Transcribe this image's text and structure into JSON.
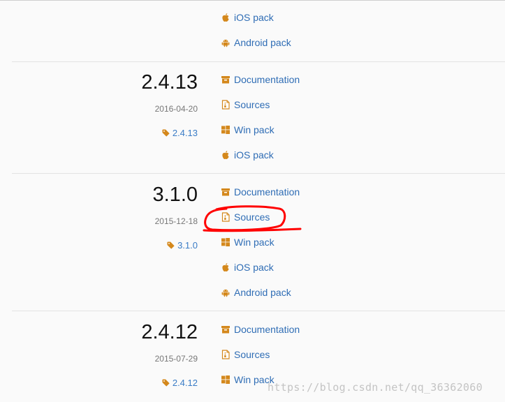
{
  "colors": {
    "icon": "#d4881c",
    "link": "#2f6db5",
    "tag": "#3a7cc6",
    "annotation": "#ff0000"
  },
  "top_links": [
    {
      "label": "iOS pack",
      "icon": "apple-icon"
    },
    {
      "label": "Android pack",
      "icon": "android-icon"
    }
  ],
  "releases": [
    {
      "version": "2.4.13",
      "date": "2016-04-20",
      "tag": "2.4.13",
      "links": [
        {
          "label": "Documentation",
          "icon": "archive-icon"
        },
        {
          "label": "Sources",
          "icon": "file-zip-icon"
        },
        {
          "label": "Win pack",
          "icon": "windows-icon"
        },
        {
          "label": "iOS pack",
          "icon": "apple-icon"
        }
      ]
    },
    {
      "version": "3.1.0",
      "date": "2015-12-18",
      "tag": "3.1.0",
      "links": [
        {
          "label": "Documentation",
          "icon": "archive-icon"
        },
        {
          "label": "Sources",
          "icon": "file-zip-icon"
        },
        {
          "label": "Win pack",
          "icon": "windows-icon"
        },
        {
          "label": "iOS pack",
          "icon": "apple-icon"
        },
        {
          "label": "Android pack",
          "icon": "android-icon"
        }
      ]
    },
    {
      "version": "2.4.12",
      "date": "2015-07-29",
      "tag": "2.4.12",
      "links": [
        {
          "label": "Documentation",
          "icon": "archive-icon"
        },
        {
          "label": "Sources",
          "icon": "file-zip-icon"
        },
        {
          "label": "Win pack",
          "icon": "windows-icon"
        }
      ]
    }
  ],
  "watermark": "https://blog.csdn.net/qq_36362060"
}
